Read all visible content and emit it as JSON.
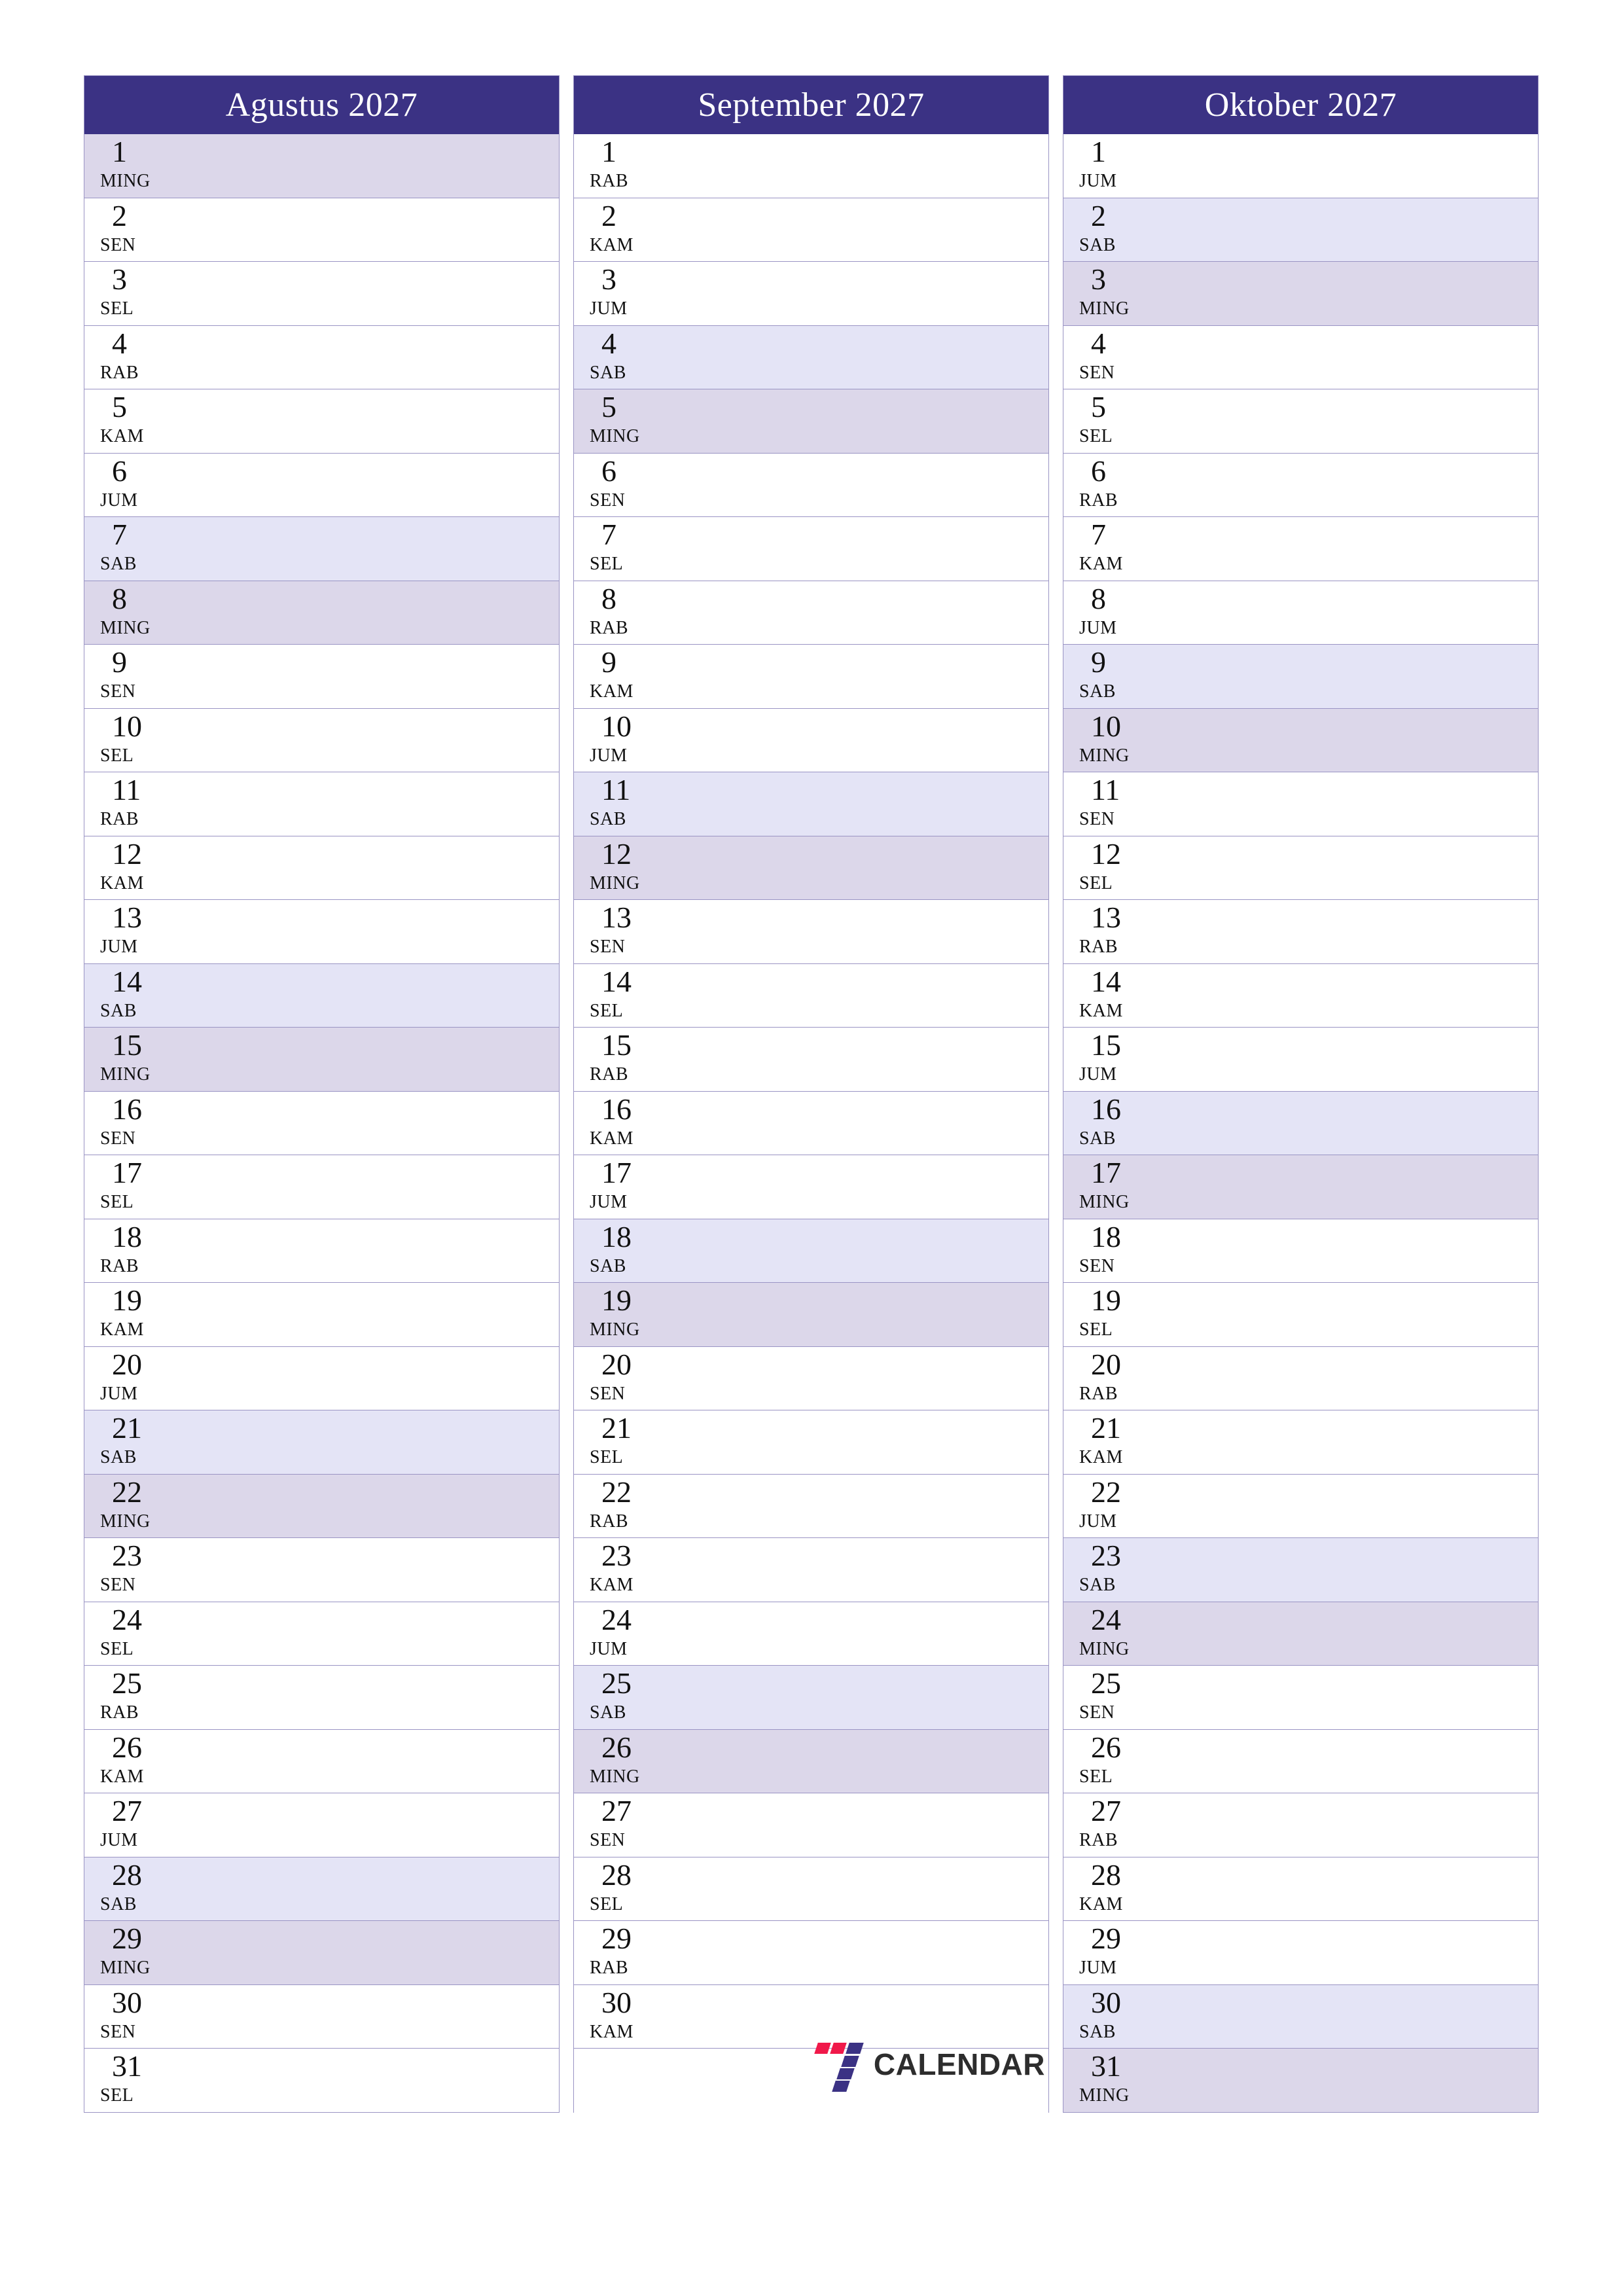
{
  "page": {
    "background_color": "#ffffff",
    "accent_color": "#3b3284",
    "saturday_color": "#e4e4f6",
    "sunday_color": "#dcd7ea",
    "grid_line_color": "#9a94c4",
    "year": "2027"
  },
  "brand": {
    "name": "CALENDAR",
    "mark_primary_color": "#3b3284",
    "mark_accent_color": "#f0194a"
  },
  "months": [
    {
      "title": "Agustus 2027",
      "days": [
        {
          "num": "1",
          "dow": "MING",
          "type": "sun"
        },
        {
          "num": "2",
          "dow": "SEN",
          "type": "weekday"
        },
        {
          "num": "3",
          "dow": "SEL",
          "type": "weekday"
        },
        {
          "num": "4",
          "dow": "RAB",
          "type": "weekday"
        },
        {
          "num": "5",
          "dow": "KAM",
          "type": "weekday"
        },
        {
          "num": "6",
          "dow": "JUM",
          "type": "weekday"
        },
        {
          "num": "7",
          "dow": "SAB",
          "type": "sat"
        },
        {
          "num": "8",
          "dow": "MING",
          "type": "sun"
        },
        {
          "num": "9",
          "dow": "SEN",
          "type": "weekday"
        },
        {
          "num": "10",
          "dow": "SEL",
          "type": "weekday"
        },
        {
          "num": "11",
          "dow": "RAB",
          "type": "weekday"
        },
        {
          "num": "12",
          "dow": "KAM",
          "type": "weekday"
        },
        {
          "num": "13",
          "dow": "JUM",
          "type": "weekday"
        },
        {
          "num": "14",
          "dow": "SAB",
          "type": "sat"
        },
        {
          "num": "15",
          "dow": "MING",
          "type": "sun"
        },
        {
          "num": "16",
          "dow": "SEN",
          "type": "weekday"
        },
        {
          "num": "17",
          "dow": "SEL",
          "type": "weekday"
        },
        {
          "num": "18",
          "dow": "RAB",
          "type": "weekday"
        },
        {
          "num": "19",
          "dow": "KAM",
          "type": "weekday"
        },
        {
          "num": "20",
          "dow": "JUM",
          "type": "weekday"
        },
        {
          "num": "21",
          "dow": "SAB",
          "type": "sat"
        },
        {
          "num": "22",
          "dow": "MING",
          "type": "sun"
        },
        {
          "num": "23",
          "dow": "SEN",
          "type": "weekday"
        },
        {
          "num": "24",
          "dow": "SEL",
          "type": "weekday"
        },
        {
          "num": "25",
          "dow": "RAB",
          "type": "weekday"
        },
        {
          "num": "26",
          "dow": "KAM",
          "type": "weekday"
        },
        {
          "num": "27",
          "dow": "JUM",
          "type": "weekday"
        },
        {
          "num": "28",
          "dow": "SAB",
          "type": "sat"
        },
        {
          "num": "29",
          "dow": "MING",
          "type": "sun"
        },
        {
          "num": "30",
          "dow": "SEN",
          "type": "weekday"
        },
        {
          "num": "31",
          "dow": "SEL",
          "type": "weekday"
        }
      ]
    },
    {
      "title": "September 2027",
      "days": [
        {
          "num": "1",
          "dow": "RAB",
          "type": "weekday"
        },
        {
          "num": "2",
          "dow": "KAM",
          "type": "weekday"
        },
        {
          "num": "3",
          "dow": "JUM",
          "type": "weekday"
        },
        {
          "num": "4",
          "dow": "SAB",
          "type": "sat"
        },
        {
          "num": "5",
          "dow": "MING",
          "type": "sun"
        },
        {
          "num": "6",
          "dow": "SEN",
          "type": "weekday"
        },
        {
          "num": "7",
          "dow": "SEL",
          "type": "weekday"
        },
        {
          "num": "8",
          "dow": "RAB",
          "type": "weekday"
        },
        {
          "num": "9",
          "dow": "KAM",
          "type": "weekday"
        },
        {
          "num": "10",
          "dow": "JUM",
          "type": "weekday"
        },
        {
          "num": "11",
          "dow": "SAB",
          "type": "sat"
        },
        {
          "num": "12",
          "dow": "MING",
          "type": "sun"
        },
        {
          "num": "13",
          "dow": "SEN",
          "type": "weekday"
        },
        {
          "num": "14",
          "dow": "SEL",
          "type": "weekday"
        },
        {
          "num": "15",
          "dow": "RAB",
          "type": "weekday"
        },
        {
          "num": "16",
          "dow": "KAM",
          "type": "weekday"
        },
        {
          "num": "17",
          "dow": "JUM",
          "type": "weekday"
        },
        {
          "num": "18",
          "dow": "SAB",
          "type": "sat"
        },
        {
          "num": "19",
          "dow": "MING",
          "type": "sun"
        },
        {
          "num": "20",
          "dow": "SEN",
          "type": "weekday"
        },
        {
          "num": "21",
          "dow": "SEL",
          "type": "weekday"
        },
        {
          "num": "22",
          "dow": "RAB",
          "type": "weekday"
        },
        {
          "num": "23",
          "dow": "KAM",
          "type": "weekday"
        },
        {
          "num": "24",
          "dow": "JUM",
          "type": "weekday"
        },
        {
          "num": "25",
          "dow": "SAB",
          "type": "sat"
        },
        {
          "num": "26",
          "dow": "MING",
          "type": "sun"
        },
        {
          "num": "27",
          "dow": "SEN",
          "type": "weekday"
        },
        {
          "num": "28",
          "dow": "SEL",
          "type": "weekday"
        },
        {
          "num": "29",
          "dow": "RAB",
          "type": "weekday"
        },
        {
          "num": "30",
          "dow": "KAM",
          "type": "weekday"
        }
      ]
    },
    {
      "title": "Oktober 2027",
      "days": [
        {
          "num": "1",
          "dow": "JUM",
          "type": "weekday"
        },
        {
          "num": "2",
          "dow": "SAB",
          "type": "sat"
        },
        {
          "num": "3",
          "dow": "MING",
          "type": "sun"
        },
        {
          "num": "4",
          "dow": "SEN",
          "type": "weekday"
        },
        {
          "num": "5",
          "dow": "SEL",
          "type": "weekday"
        },
        {
          "num": "6",
          "dow": "RAB",
          "type": "weekday"
        },
        {
          "num": "7",
          "dow": "KAM",
          "type": "weekday"
        },
        {
          "num": "8",
          "dow": "JUM",
          "type": "weekday"
        },
        {
          "num": "9",
          "dow": "SAB",
          "type": "sat"
        },
        {
          "num": "10",
          "dow": "MING",
          "type": "sun"
        },
        {
          "num": "11",
          "dow": "SEN",
          "type": "weekday"
        },
        {
          "num": "12",
          "dow": "SEL",
          "type": "weekday"
        },
        {
          "num": "13",
          "dow": "RAB",
          "type": "weekday"
        },
        {
          "num": "14",
          "dow": "KAM",
          "type": "weekday"
        },
        {
          "num": "15",
          "dow": "JUM",
          "type": "weekday"
        },
        {
          "num": "16",
          "dow": "SAB",
          "type": "sat"
        },
        {
          "num": "17",
          "dow": "MING",
          "type": "sun"
        },
        {
          "num": "18",
          "dow": "SEN",
          "type": "weekday"
        },
        {
          "num": "19",
          "dow": "SEL",
          "type": "weekday"
        },
        {
          "num": "20",
          "dow": "RAB",
          "type": "weekday"
        },
        {
          "num": "21",
          "dow": "KAM",
          "type": "weekday"
        },
        {
          "num": "22",
          "dow": "JUM",
          "type": "weekday"
        },
        {
          "num": "23",
          "dow": "SAB",
          "type": "sat"
        },
        {
          "num": "24",
          "dow": "MING",
          "type": "sun"
        },
        {
          "num": "25",
          "dow": "SEN",
          "type": "weekday"
        },
        {
          "num": "26",
          "dow": "SEL",
          "type": "weekday"
        },
        {
          "num": "27",
          "dow": "RAB",
          "type": "weekday"
        },
        {
          "num": "28",
          "dow": "KAM",
          "type": "weekday"
        },
        {
          "num": "29",
          "dow": "JUM",
          "type": "weekday"
        },
        {
          "num": "30",
          "dow": "SAB",
          "type": "sat"
        },
        {
          "num": "31",
          "dow": "MING",
          "type": "sun"
        }
      ]
    }
  ]
}
